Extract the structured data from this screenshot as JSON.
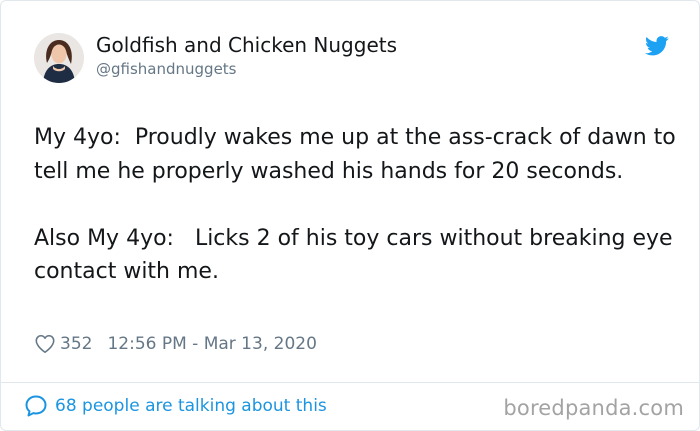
{
  "tweet": {
    "display_name": "Goldfish and Chicken Nuggets",
    "handle": "@gfishandnuggets",
    "paragraphs": [
      "My 4yo:  Proudly wakes me up at the ass-crack of dawn to tell me he properly washed his hands for 20 seconds.",
      "Also My 4yo:   Licks 2 of his toy cars without breaking eye contact with me."
    ],
    "likes": "352",
    "timestamp": "12:56 PM - Mar 13, 2020"
  },
  "footer": {
    "conversation_text": "68 people are talking about this",
    "watermark": "boredpanda.com"
  },
  "colors": {
    "twitter_blue": "#1da1f2",
    "link_blue": "#1b95e0",
    "muted": "#657786",
    "border": "#e1e8ed",
    "watermark": "#a3a3a3"
  },
  "icons": {
    "bird": "twitter-bird-icon",
    "like": "heart-icon",
    "reply": "speech-bubble-icon"
  }
}
